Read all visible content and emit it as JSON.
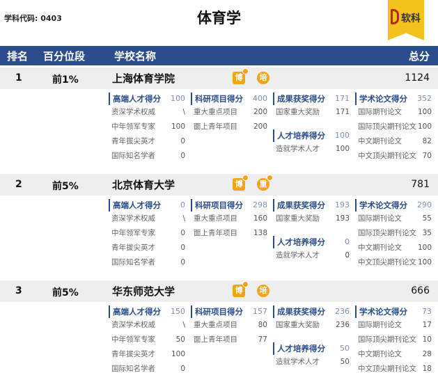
{
  "header": {
    "subject_code": "学科代码: 0403",
    "title": "体育学",
    "brand": "软科"
  },
  "columns": {
    "rank": "排名",
    "percentile": "百分位段",
    "school": "学校名称",
    "total": "总分"
  },
  "schools": [
    {
      "rank": "1",
      "percentile": "前1%",
      "name": "上海体育学院",
      "total": "1124",
      "badges": [
        "博",
        "培"
      ],
      "talent": {
        "title": "高端人才得分",
        "value": "100",
        "items": [
          {
            "label": "资深学术权威",
            "value": "\\"
          },
          {
            "label": "中年领军专家",
            "value": "100"
          },
          {
            "label": "青年拔尖英才",
            "value": "0"
          },
          {
            "label": "国际知名学者",
            "value": "0"
          }
        ]
      },
      "research": {
        "title": "科研项目得分",
        "value": "400",
        "items": [
          {
            "label": "重大重点项目",
            "value": "200"
          },
          {
            "label": "面上青年项目",
            "value": "200"
          }
        ]
      },
      "awards": {
        "title": "成果获奖得分",
        "value": "171",
        "items": [
          {
            "label": "国家重大奖励",
            "value": "171"
          }
        ]
      },
      "training": {
        "title": "人才培养得分",
        "value": "100",
        "items": [
          {
            "label": "造就学术人才",
            "value": "100"
          }
        ]
      },
      "papers": {
        "title": "学术论文得分",
        "value": "352",
        "items": [
          {
            "label": "国际期刊论文",
            "value": "100"
          },
          {
            "label": "国际顶尖期刊论文",
            "value": "100"
          },
          {
            "label": "中文期刊论文",
            "value": "82"
          },
          {
            "label": "中文顶尖期刊论文",
            "value": "70"
          }
        ]
      }
    },
    {
      "rank": "2",
      "percentile": "前5%",
      "name": "北京体育大学",
      "total": "781",
      "badges": [
        "博",
        "重"
      ],
      "talent": {
        "title": "高端人才得分",
        "value": "0",
        "items": [
          {
            "label": "资深学术权威",
            "value": "\\"
          },
          {
            "label": "中年领军专家",
            "value": "0"
          },
          {
            "label": "青年拔尖英才",
            "value": "0"
          },
          {
            "label": "国际知名学者",
            "value": "0"
          }
        ]
      },
      "research": {
        "title": "科研项目得分",
        "value": "298",
        "items": [
          {
            "label": "重大重点项目",
            "value": "160"
          },
          {
            "label": "面上青年项目",
            "value": "138"
          }
        ]
      },
      "awards": {
        "title": "成果获奖得分",
        "value": "193",
        "items": [
          {
            "label": "国家重大奖励",
            "value": "193"
          }
        ]
      },
      "training": {
        "title": "人才培养得分",
        "value": "0",
        "items": [
          {
            "label": "造就学术人才",
            "value": "0"
          }
        ]
      },
      "papers": {
        "title": "学术论文得分",
        "value": "290",
        "items": [
          {
            "label": "国际期刊论文",
            "value": "55"
          },
          {
            "label": "国际顶尖期刊论文",
            "value": "35"
          },
          {
            "label": "中文期刊论文",
            "value": "100"
          },
          {
            "label": "中文顶尖期刊论文",
            "value": "100"
          }
        ]
      }
    },
    {
      "rank": "3",
      "percentile": "前5%",
      "name": "华东师范大学",
      "total": "666",
      "badges": [
        "博",
        "培"
      ],
      "talent": {
        "title": "高端人才得分",
        "value": "150",
        "items": [
          {
            "label": "资深学术权威",
            "value": "\\"
          },
          {
            "label": "中年领军专家",
            "value": "50"
          },
          {
            "label": "青年拔尖英才",
            "value": "100"
          },
          {
            "label": "国际知名学者",
            "value": "0"
          }
        ]
      },
      "research": {
        "title": "科研项目得分",
        "value": "157",
        "items": [
          {
            "label": "重大重点项目",
            "value": "80"
          },
          {
            "label": "面上青年项目",
            "value": "77"
          }
        ]
      },
      "awards": {
        "title": "成果获奖得分",
        "value": "236",
        "items": [
          {
            "label": "国家重大奖励",
            "value": "236"
          }
        ]
      },
      "training": {
        "title": "人才培养得分",
        "value": "50",
        "items": [
          {
            "label": "造就学术人才",
            "value": "50"
          }
        ]
      },
      "papers": {
        "title": "学术论文得分",
        "value": "73",
        "items": [
          {
            "label": "国际期刊论文",
            "value": "17"
          },
          {
            "label": "国际顶尖期刊论文",
            "value": "10"
          },
          {
            "label": "中文期刊论文",
            "value": "28"
          },
          {
            "label": "中文顶尖期刊论文",
            "value": "18"
          }
        ]
      }
    }
  ]
}
